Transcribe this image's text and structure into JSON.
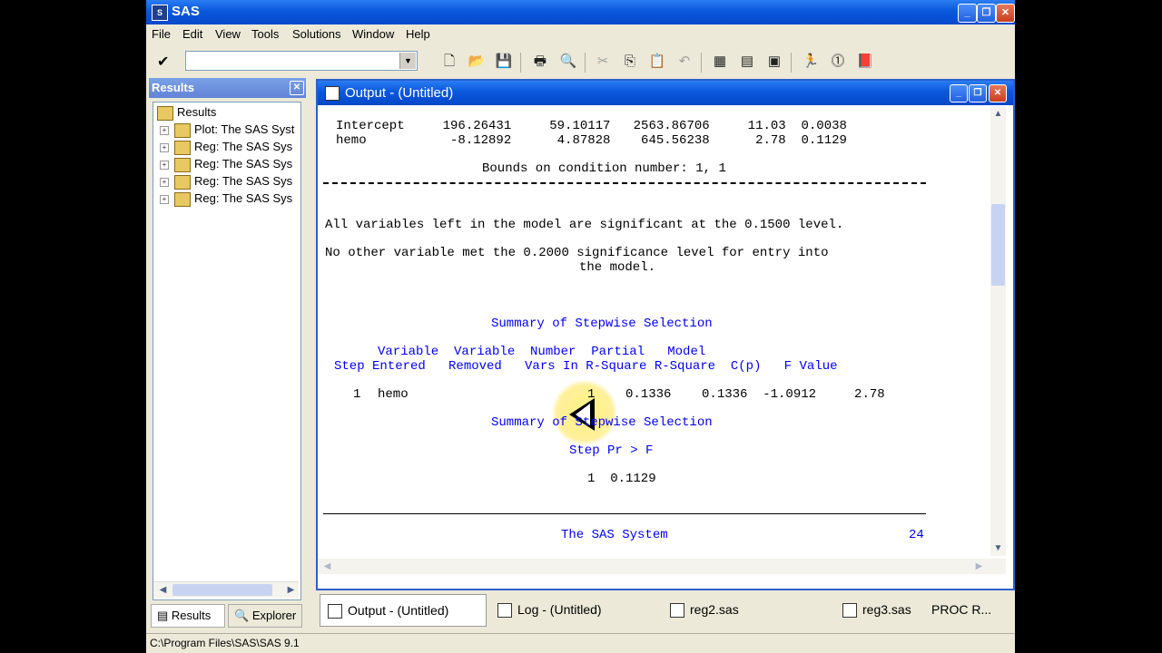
{
  "app": {
    "title": "SAS"
  },
  "menu": [
    "File",
    "Edit",
    "View",
    "Tools",
    "Solutions",
    "Window",
    "Help"
  ],
  "toolbar": {
    "command_value": ""
  },
  "results_panel": {
    "title": "Results",
    "root": "Results",
    "items": [
      "Plot: The SAS Syst",
      "Reg: The SAS Sys",
      "Reg: The SAS Sys",
      "Reg: The SAS Sys",
      "Reg: The SAS Sys"
    ],
    "tabs": [
      "Results",
      "Explorer"
    ]
  },
  "output_window": {
    "title": "Output - (Untitled)",
    "lines": {
      "intercept_row": "Intercept     196.26431     59.10117   2563.86706     11.03  0.0038",
      "hemo_row": "hemo           -8.12892      4.87828    645.56238      2.78  0.1129",
      "bounds": "Bounds on condition number: 1, 1",
      "sig_note": "All variables left in the model are significant at the 0.1500 level.",
      "entry_note_1": "No other variable met the 0.2000 significance level for entry into",
      "entry_note_2": "the model.",
      "summary_title_1": "Summary of Stepwise Selection",
      "header_1": "Variable  Variable  Number  Partial   Model",
      "header_2": "Step Entered   Removed   Vars In R-Square R-Square  C(p)   F Value",
      "row_step": "1",
      "row_var": "hemo",
      "row_rest": "1    0.1336    0.1336  -1.0912     2.78",
      "summary_title_2": "Summary of Stepwise Selection",
      "header_3": "Step Pr > F",
      "row_2": "1  0.1129",
      "footer_title": "The SAS System",
      "footer_page": "24"
    }
  },
  "taskbar": [
    "Output - (Untitled)",
    "Log - (Untitled)",
    "reg2.sas",
    "reg3.sas",
    "PROC R..."
  ],
  "status": {
    "path": "C:\\Program Files\\SAS\\SAS 9.1"
  }
}
